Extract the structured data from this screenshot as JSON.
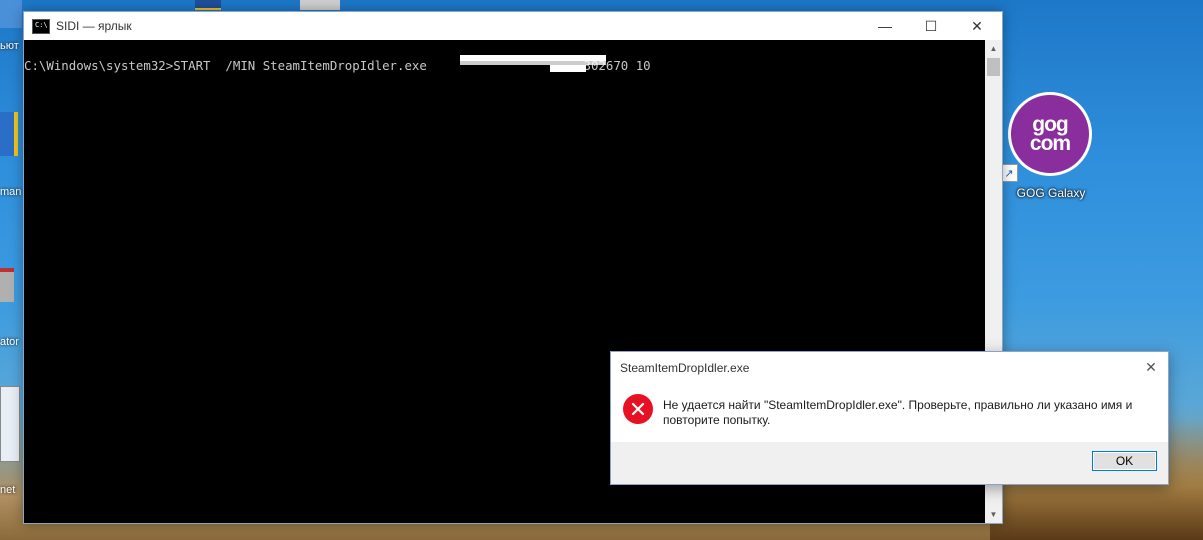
{
  "console": {
    "title": "SIDI — ярлык",
    "icon_text": "C:\\",
    "command_line": "C:\\Windows\\system32>START  /MIN SteamItemDropIdler.exe                     302670 10",
    "controls": {
      "minimize": "—",
      "maximize": "☐",
      "close": "✕"
    }
  },
  "dialog": {
    "title": "SteamItemDropIdler.exe",
    "message": "Не удается найти \"SteamItemDropIdler.exe\". Проверьте, правильно ли указано имя и повторите попытку.",
    "ok_label": "OK",
    "close": "✕"
  },
  "desktop": {
    "gog_line1": "gog",
    "gog_line2": "com",
    "gog_label": "GOG Galaxy",
    "left_labels": [
      "ьют",
      "man",
      "ator",
      "net"
    ]
  }
}
